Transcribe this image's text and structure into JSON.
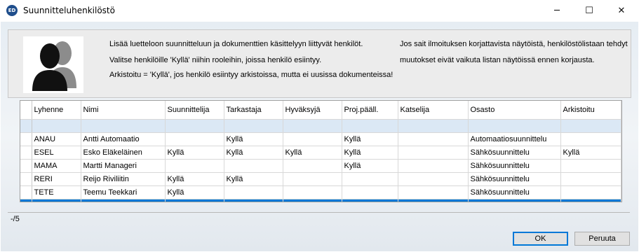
{
  "window": {
    "icon_label": "ED",
    "title": "Suunnitteluhenkilöstö",
    "minimize_glyph": "─",
    "maximize_glyph": "☐",
    "close_glyph": "✕"
  },
  "header": {
    "line1": "Lisää luetteloon suunnitteluun ja dokumenttien käsittelyyn liittyvät henkilöt.",
    "line2": "Valitse henkilöille 'Kyllä' niihin rooleihin, joissa henkilö esiintyy.",
    "line3": "Arkistoitu = 'Kyllä', jos henkilö esiintyy arkistoissa, mutta ei uusissa dokumenteissa!",
    "note1": "Jos sait ilmoituksen korjattavista näytöistä, henkilöstölistaan tehdyt",
    "note2": "muutokset eivät vaikuta listan näytöissä ennen korjausta."
  },
  "table": {
    "columns": [
      "Lyhenne",
      "Nimi",
      "Suunnittelija",
      "Tarkastaja",
      "Hyväksyjä",
      "Proj.pääll.",
      "Katselija",
      "Osasto",
      "Arkistoitu"
    ],
    "rows": [
      [
        "ANAU",
        "Antti Automaatio",
        "",
        "Kyllä",
        "",
        "Kyllä",
        "",
        "Automaatiosuunnittelu",
        ""
      ],
      [
        "ESEL",
        "Esko Eläkeläinen",
        "Kyllä",
        "Kyllä",
        "Kyllä",
        "Kyllä",
        "",
        "Sähkösuunnittelu",
        "Kyllä"
      ],
      [
        "MAMA",
        "Martti Manageri",
        "",
        "",
        "",
        "Kyllä",
        "",
        "Sähkösuunnittelu",
        ""
      ],
      [
        "RERI",
        "Reijo Riviliitin",
        "Kyllä",
        "Kyllä",
        "",
        "",
        "",
        "Sähkösuunnittelu",
        ""
      ],
      [
        "TETE",
        "Teemu Teekkari",
        "Kyllä",
        "",
        "",
        "",
        "",
        "Sähkösuunnittelu",
        ""
      ]
    ]
  },
  "status": {
    "text": "-/5"
  },
  "buttons": {
    "ok": "OK",
    "cancel": "Peruuta"
  },
  "colors": {
    "selection": "#0078d7",
    "empty_row": "#dbe8f5"
  }
}
